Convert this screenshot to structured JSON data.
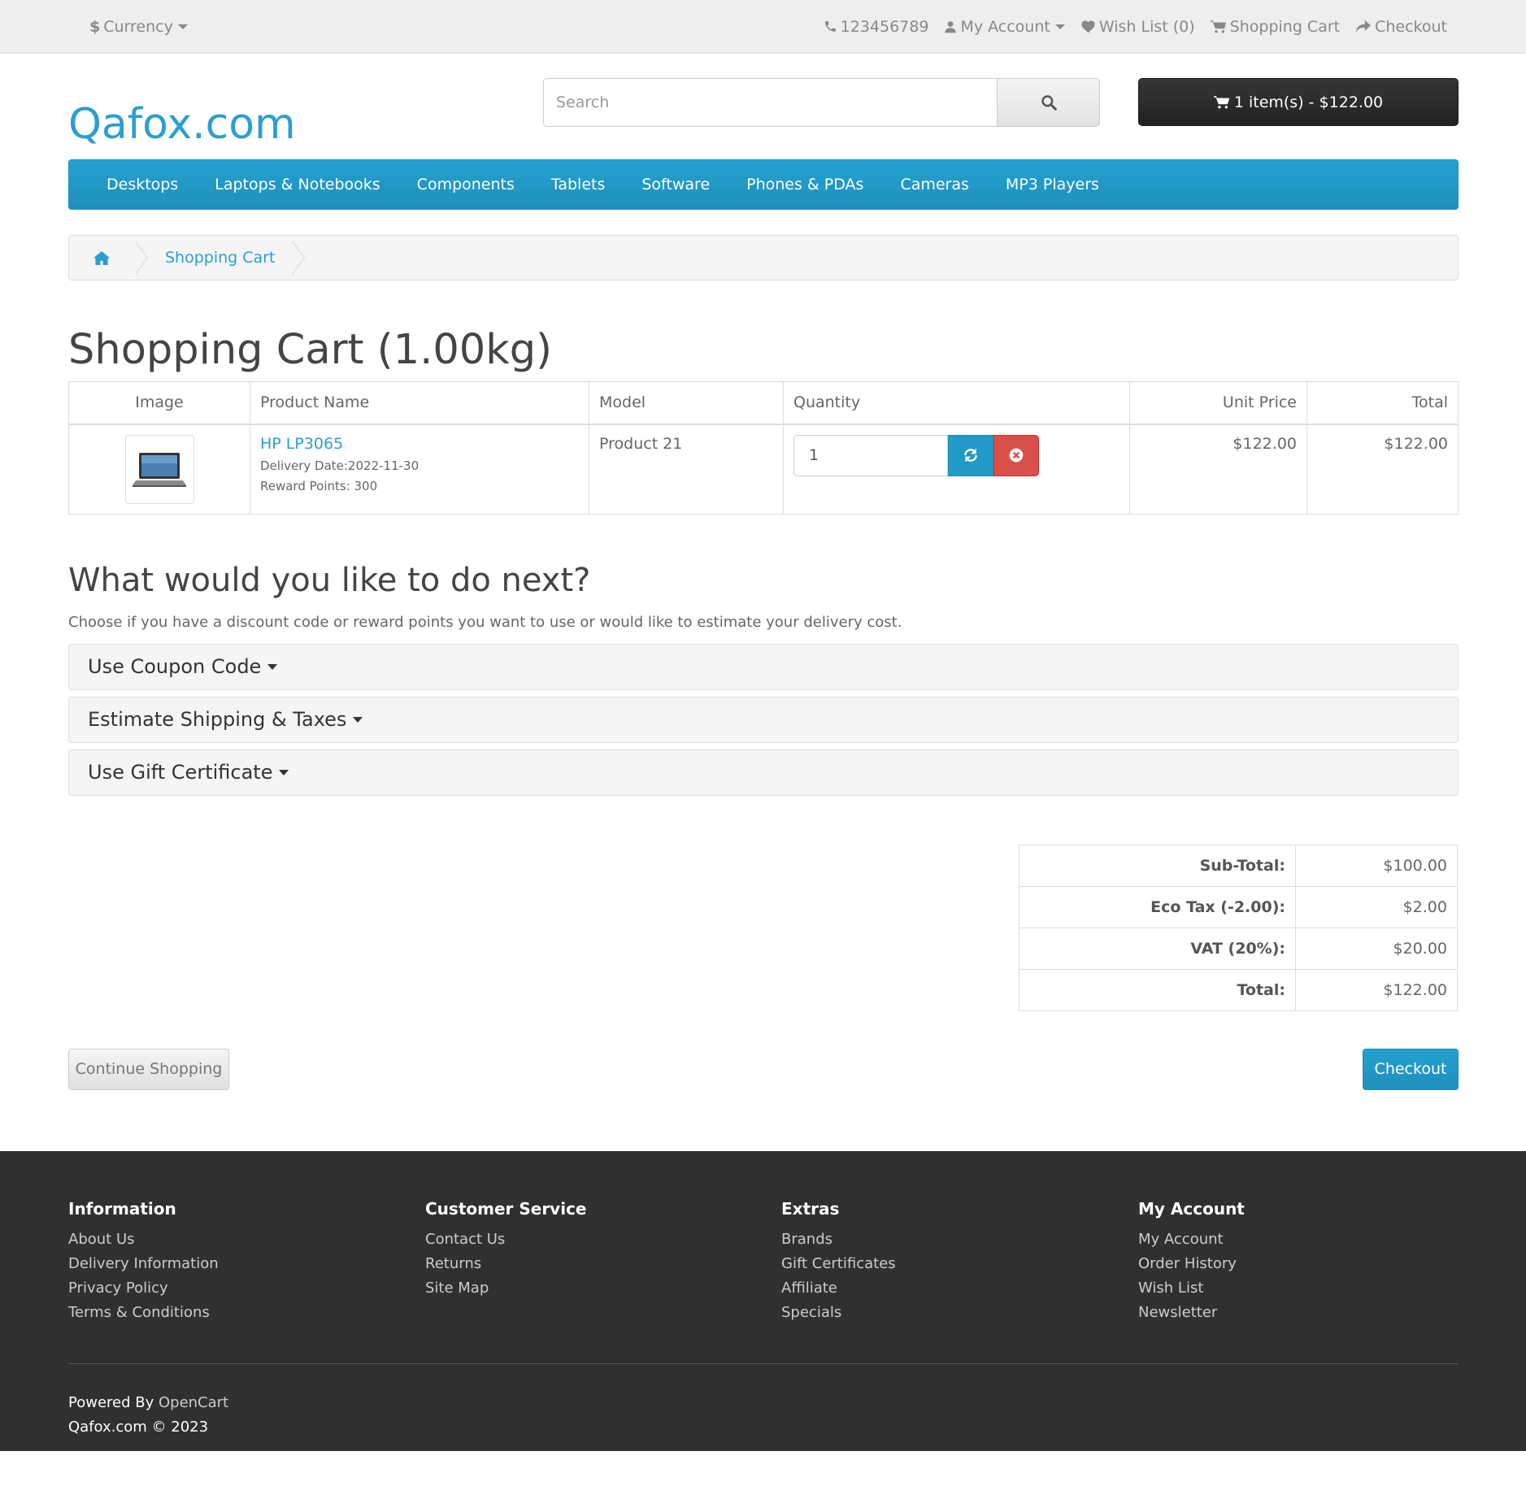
{
  "topbar": {
    "currency_label": "Currency",
    "phone": "123456789",
    "my_account": "My Account",
    "wish_list": "Wish List (0)",
    "shopping_cart": "Shopping Cart",
    "checkout": "Checkout"
  },
  "header": {
    "logo": "Qafox.com",
    "search_placeholder": "Search",
    "cart_button": "1 item(s) - $122.00"
  },
  "menu": [
    "Desktops",
    "Laptops & Notebooks",
    "Components",
    "Tablets",
    "Software",
    "Phones & PDAs",
    "Cameras",
    "MP3 Players"
  ],
  "breadcrumb": {
    "current": "Shopping Cart"
  },
  "page_title": "Shopping Cart  (1.00kg)",
  "cart_table": {
    "headers": {
      "image": "Image",
      "product_name": "Product Name",
      "model": "Model",
      "quantity": "Quantity",
      "unit_price": "Unit Price",
      "total": "Total"
    },
    "rows": [
      {
        "product_name": "HP LP3065",
        "delivery_date": "Delivery Date:2022-11-30",
        "reward_points": "Reward Points: 300",
        "model": "Product 21",
        "quantity": "1",
        "unit_price": "$122.00",
        "total": "$122.00"
      }
    ]
  },
  "next_section": {
    "title": "What would you like to do next?",
    "description": "Choose if you have a discount code or reward points you want to use or would like to estimate your delivery cost.",
    "panels": [
      "Use Coupon Code",
      "Estimate Shipping & Taxes",
      "Use Gift Certificate"
    ]
  },
  "totals": [
    {
      "label": "Sub-Total:",
      "value": "$100.00"
    },
    {
      "label": "Eco Tax (-2.00):",
      "value": "$2.00"
    },
    {
      "label": "VAT (20%):",
      "value": "$20.00"
    },
    {
      "label": "Total:",
      "value": "$122.00"
    }
  ],
  "buttons": {
    "continue_shopping": "Continue Shopping",
    "checkout": "Checkout"
  },
  "footer": {
    "columns": [
      {
        "title": "Information",
        "links": [
          "About Us",
          "Delivery Information",
          "Privacy Policy",
          "Terms & Conditions"
        ]
      },
      {
        "title": "Customer Service",
        "links": [
          "Contact Us",
          "Returns",
          "Site Map"
        ]
      },
      {
        "title": "Extras",
        "links": [
          "Brands",
          "Gift Certificates",
          "Affiliate",
          "Specials"
        ]
      },
      {
        "title": "My Account",
        "links": [
          "My Account",
          "Order History",
          "Wish List",
          "Newsletter"
        ]
      }
    ],
    "powered_by_label": "Powered By",
    "powered_by_link": "OpenCart",
    "copyright": "Qafox.com © 2023"
  },
  "colors": {
    "brand": "#2b9ed2",
    "menu": "#229ac8",
    "danger": "#da4f49",
    "footer": "#303030"
  }
}
